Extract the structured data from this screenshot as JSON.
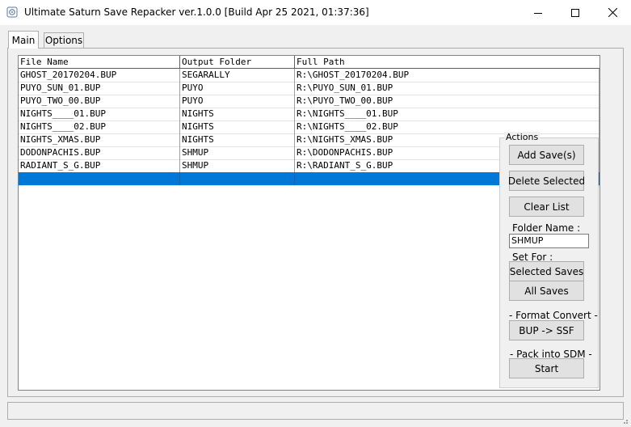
{
  "window": {
    "title": "Ultimate Saturn Save Repacker ver.1.0.0 [Build Apr 25 2021, 01:37:36]"
  },
  "tabs": [
    {
      "label": "Main",
      "active": true
    },
    {
      "label": "Options",
      "active": false
    }
  ],
  "list": {
    "headers": [
      "File Name",
      "Output Folder",
      "Full Path"
    ],
    "rows": [
      [
        "GHOST_20170204.BUP",
        "SEGARALLY",
        "R:\\GHOST_20170204.BUP"
      ],
      [
        "PUYO_SUN_01.BUP",
        "PUYO",
        "R:\\PUYO_SUN_01.BUP"
      ],
      [
        "PUYO_TWO_00.BUP",
        "PUYO",
        "R:\\PUYO_TWO_00.BUP"
      ],
      [
        "NIGHTS____01.BUP",
        "NIGHTS",
        "R:\\NIGHTS____01.BUP"
      ],
      [
        "NIGHTS____02.BUP",
        "NIGHTS",
        "R:\\NIGHTS____02.BUP"
      ],
      [
        "NIGHTS_XMAS.BUP",
        "NIGHTS",
        "R:\\NIGHTS_XMAS.BUP"
      ],
      [
        "DODONPACHIS.BUP",
        "SHMUP",
        "R:\\DODONPACHIS.BUP"
      ],
      [
        "RADIANT_S_G.BUP",
        "SHMUP",
        "R:\\RADIANT_S_G.BUP"
      ],
      [
        "",
        "",
        ""
      ]
    ]
  },
  "actions": {
    "legend": "Actions",
    "add_label": "Add Save(s)",
    "delete_label": "Delete Selected",
    "clear_label": "Clear List",
    "folder_name_label": "Folder Name :",
    "folder_name_value": "SHMUP",
    "set_for_label": "Set For :",
    "selected_saves_label": "Selected Saves",
    "all_saves_label": "All Saves",
    "format_convert_label": "- Format Convert -",
    "bup_ssf_label": "BUP -> SSF",
    "pack_sdm_label": "- Pack into SDM -",
    "start_label": "Start"
  },
  "colors": {
    "selection": "#0078d7",
    "button_face": "#e1e1e1",
    "window_bg": "#f0f0f0"
  }
}
